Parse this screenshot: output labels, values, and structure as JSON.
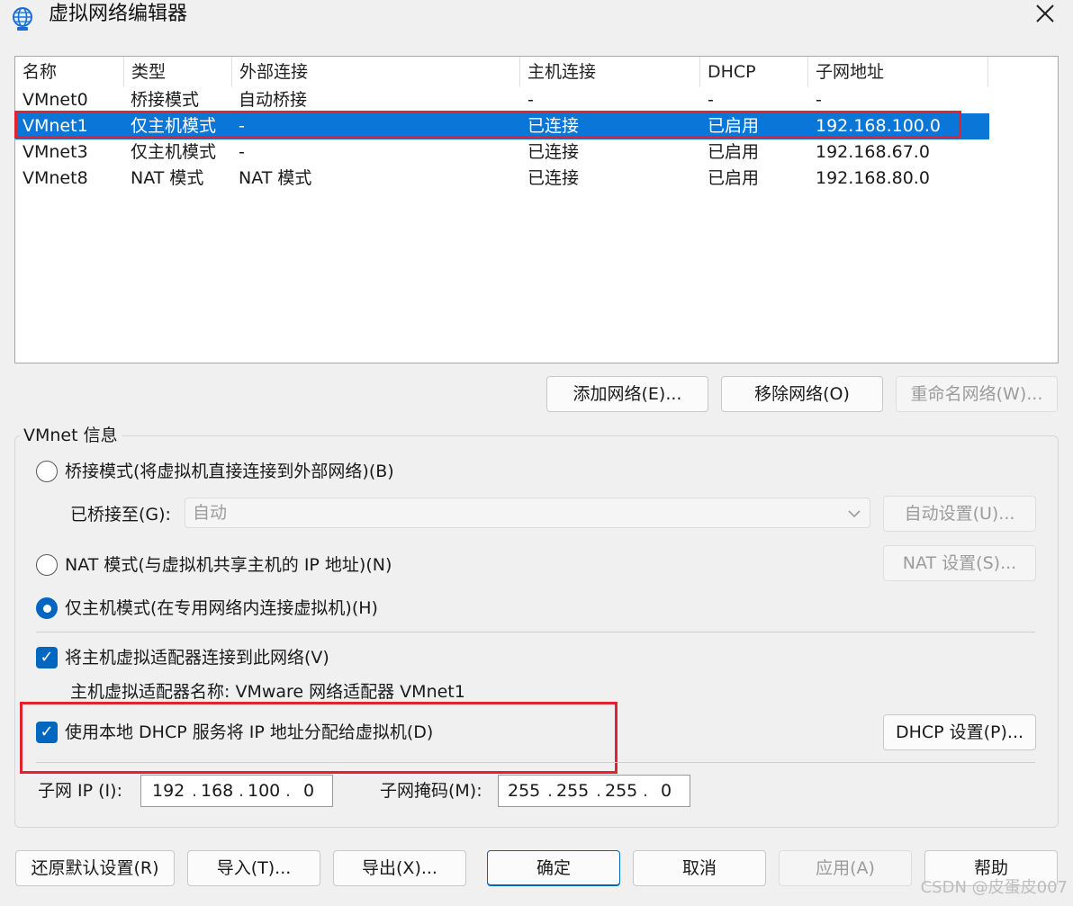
{
  "window": {
    "title": "虚拟网络编辑器",
    "icon": "globe-network-icon",
    "close_glyph": "✕"
  },
  "list": {
    "columns": [
      "名称",
      "类型",
      "外部连接",
      "主机连接",
      "DHCP",
      "子网地址"
    ],
    "rows": [
      [
        "VMnet0",
        "桥接模式",
        "自动桥接",
        "-",
        "-",
        "-"
      ],
      [
        "VMnet1",
        "仅主机模式",
        "-",
        "已连接",
        "已启用",
        "192.168.100.0"
      ],
      [
        "VMnet3",
        "仅主机模式",
        "-",
        "已连接",
        "已启用",
        "192.168.67.0"
      ],
      [
        "VMnet8",
        "NAT 模式",
        "NAT 模式",
        "已连接",
        "已启用",
        "192.168.80.0"
      ]
    ],
    "selected_row": 1
  },
  "list_buttons": {
    "add": "添加网络(E)...",
    "remove": "移除网络(O)",
    "rename": "重命名网络(W)..."
  },
  "info": {
    "group_title": "VMnet 信息",
    "bridged_label": "桥接模式(将虚拟机直接连接到外部网络)(B)",
    "bridged_to_label": "已桥接至(G):",
    "bridged_to_value": "自动",
    "auto_settings_button": "自动设置(U)...",
    "nat_label": "NAT 模式(与虚拟机共享主机的 IP 地址)(N)",
    "nat_settings_button": "NAT 设置(S)...",
    "hostonly_label": "仅主机模式(在专用网络内连接虚拟机)(H)",
    "connect_adapter_label": "将主机虚拟适配器连接到此网络(V)",
    "adapter_name_label": "主机虚拟适配器名称: VMware 网络适配器 VMnet1",
    "dhcp_label": "使用本地 DHCP 服务将 IP 地址分配给虚拟机(D)",
    "dhcp_settings_button": "DHCP 设置(P)...",
    "subnet_ip_label": "子网 IP (I):",
    "subnet_ip": [
      "192",
      "168",
      "100",
      "0"
    ],
    "subnet_mask_label": "子网掩码(M):",
    "subnet_mask": [
      "255",
      "255",
      "255",
      "0"
    ],
    "mode_selected": "hostonly",
    "connect_adapter_checked": true,
    "dhcp_checked": true
  },
  "footer_buttons": {
    "restore": "还原默认设置(R)",
    "import": "导入(T)...",
    "export": "导出(X)...",
    "ok": "确定",
    "cancel": "取消",
    "apply": "应用(A)",
    "help": "帮助"
  },
  "watermark": "CSDN @皮蛋皮007",
  "colors": {
    "selection": "#0a76d8",
    "accent": "#0067c0",
    "annotation_red": "#e4212f"
  }
}
